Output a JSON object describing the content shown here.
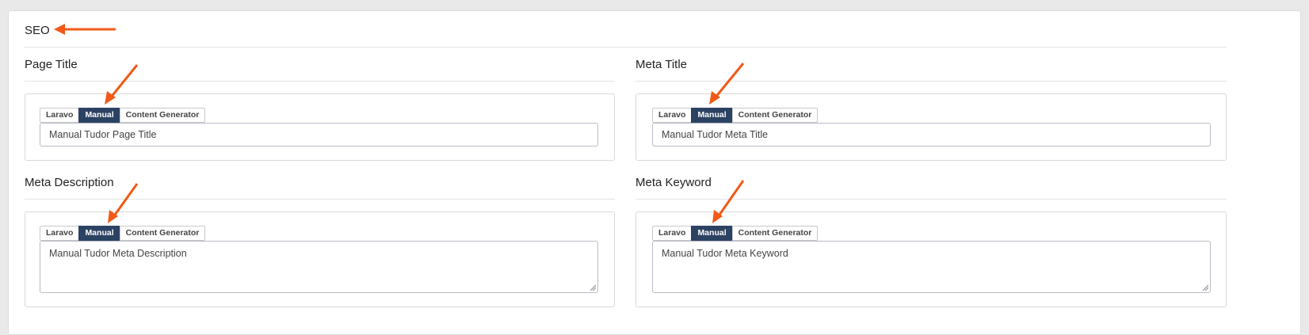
{
  "section_title": "SEO",
  "accent_color": "#f05a16",
  "active_tab_color": "#2c4263",
  "tab_labels": {
    "laravo": "Laravo",
    "manual": "Manual",
    "content_generator": "Content Generator"
  },
  "panels": {
    "page_title": {
      "heading": "Page Title",
      "active_tab": "Manual",
      "value": "Manual Tudor Page Title"
    },
    "meta_title": {
      "heading": "Meta Title",
      "active_tab": "Manual",
      "value": "Manual Tudor Meta Title"
    },
    "meta_description": {
      "heading": "Meta Description",
      "active_tab": "Manual",
      "value": "Manual Tudor Meta Description"
    },
    "meta_keyword": {
      "heading": "Meta Keyword",
      "active_tab": "Manual",
      "value": "Manual Tudor Meta Keyword"
    }
  },
  "annotation_icons": [
    "arrow-left-icon",
    "arrow-down-left-icon"
  ]
}
